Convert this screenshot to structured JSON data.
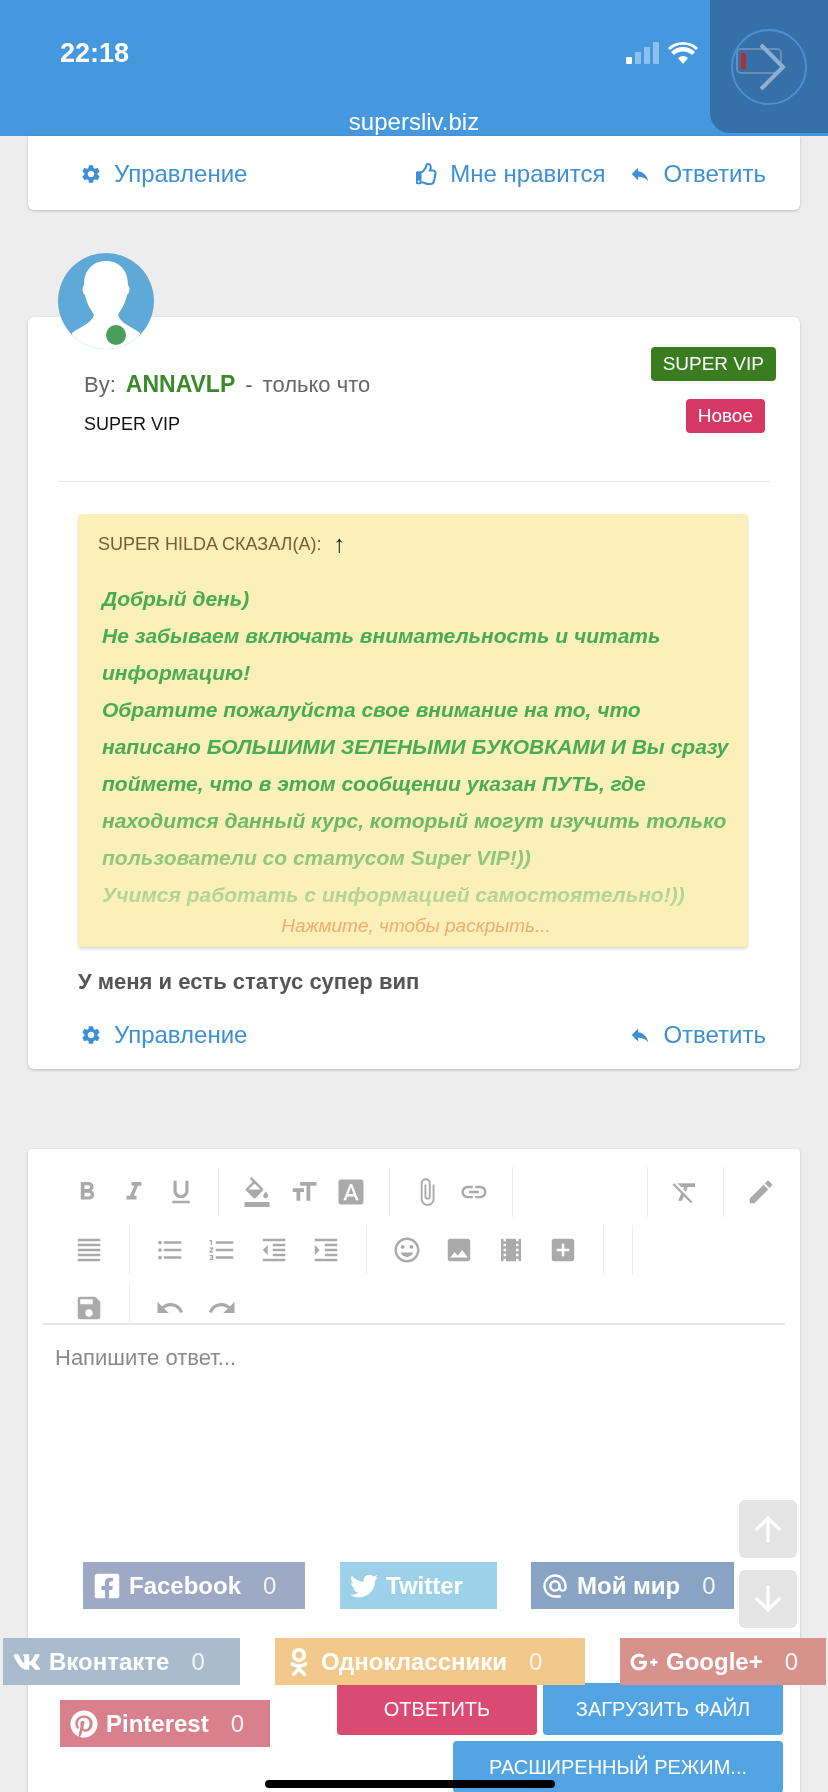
{
  "status_bar": {
    "time": "22:18"
  },
  "address_bar": {
    "url": "supersliv.biz"
  },
  "previous_post": {
    "actions": [
      {
        "kind": "manage",
        "label": "Управление"
      },
      {
        "kind": "like",
        "label": "Мне нравится"
      },
      {
        "kind": "reply",
        "label": "Ответить"
      }
    ]
  },
  "post": {
    "online": true,
    "by_label": "By:",
    "author": "ANNAVLP",
    "separator": "-",
    "time": "только что",
    "user_title": "SUPER VIP",
    "badges": [
      {
        "label": "SUPER VIP",
        "color": "#3a7d21"
      },
      {
        "label": "Новое",
        "color": "#d63864"
      }
    ],
    "quote": {
      "header": "SUPER HILDA СКАЗАЛ(А):",
      "jump": "↑",
      "lines": [
        "Добрый день)",
        "Не забываем включать внимательность и читать информацию!",
        "Обратите пожалуйста свое внимание на то, что написано БОЛЬШИМИ ЗЕЛЕНЫМИ БУКОВКАМИ И Вы сразу поймете, что в этом сообщении указан ПУТЬ, где находится данный курс, который могут изучить только пользователи со статусом Super VIP!))",
        "Учимся работать с информацией самостоятельно!))"
      ],
      "expand": "Нажмите, чтобы раскрыть..."
    },
    "message": "У меня и есть статус супер вип",
    "actions": [
      {
        "kind": "manage",
        "label": "Управление"
      },
      {
        "kind": "reply",
        "label": "Ответить"
      }
    ]
  },
  "editor": {
    "placeholder": "Напишите ответ...",
    "buttons": [
      {
        "kind": "primary",
        "label": "ОТВЕТИТЬ"
      },
      {
        "kind": "secondary",
        "label": "ЗАГРУЗИТЬ ФАЙЛ"
      },
      {
        "kind": "secondary",
        "label": "РАСШИРЕННЫЙ РЕЖИМ..."
      }
    ]
  },
  "share": [
    {
      "kind": "facebook",
      "label": "Facebook",
      "count": "0",
      "color": "#9ea9c6"
    },
    {
      "kind": "twitter",
      "label": "Twitter",
      "color": "#9dd1ea"
    },
    {
      "kind": "mymir",
      "label": "Мой мир",
      "count": "0",
      "color": "#88a3c3"
    },
    {
      "kind": "vk",
      "label": "Вконтакте",
      "count": "0",
      "color": "#a9bccd"
    },
    {
      "kind": "ok",
      "label": "Одноклассники",
      "count": "0",
      "color": "#f2c98a"
    },
    {
      "kind": "google",
      "label": "Google+",
      "count": "0",
      "color": "#d8928c"
    },
    {
      "kind": "pinterest",
      "label": "Pinterest",
      "count": "0",
      "color": "#d8818c"
    }
  ]
}
